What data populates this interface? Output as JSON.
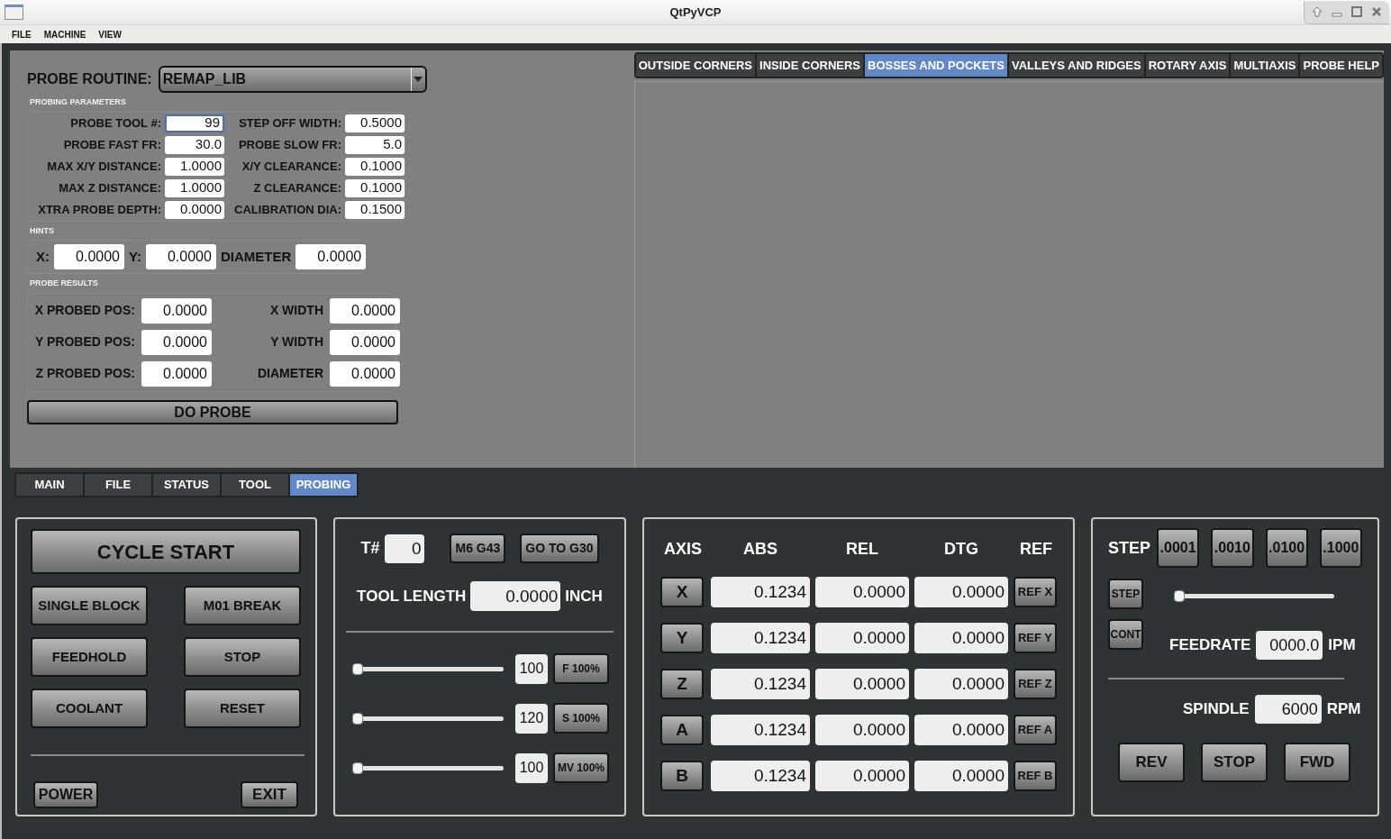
{
  "window": {
    "title": "QtPyVCP"
  },
  "menu": [
    "FILE",
    "MACHINE",
    "VIEW"
  ],
  "probe_routine": {
    "label": "PROBE ROUTINE:",
    "value": "REMAP_LIB"
  },
  "probing_parameters": {
    "title": "PROBING PARAMETERS",
    "fields": [
      {
        "label": "PROBE TOOL #:",
        "value": "99",
        "focused": true
      },
      {
        "label": "STEP OFF WIDTH:",
        "value": "0.5000",
        "focused": false
      },
      {
        "label": "PROBE FAST FR:",
        "value": "30.0",
        "focused": false
      },
      {
        "label": "PROBE SLOW FR:",
        "value": "5.0",
        "focused": false
      },
      {
        "label": "MAX X/Y DISTANCE:",
        "value": "1.0000",
        "focused": false
      },
      {
        "label": "X/Y CLEARANCE:",
        "value": "0.1000",
        "focused": false
      },
      {
        "label": "MAX Z DISTANCE:",
        "value": "1.0000",
        "focused": false
      },
      {
        "label": "Z CLEARANCE:",
        "value": "0.1000",
        "focused": false
      },
      {
        "label": "XTRA PROBE DEPTH:",
        "value": "0.0000",
        "focused": false
      },
      {
        "label": "CALIBRATION DIA:",
        "value": "0.1500",
        "focused": false
      }
    ]
  },
  "hints": {
    "title": "HINTS",
    "fields": [
      {
        "label": "X:",
        "value": "0.0000"
      },
      {
        "label": "Y:",
        "value": "0.0000"
      },
      {
        "label": "DIAMETER",
        "value": "0.0000"
      }
    ]
  },
  "probe_results": {
    "title": "PROBE RESULTS",
    "fields": [
      {
        "label": "X PROBED POS:",
        "value": "0.0000"
      },
      {
        "label": "X WIDTH",
        "value": "0.0000"
      },
      {
        "label": "Y PROBED POS:",
        "value": "0.0000"
      },
      {
        "label": "Y WIDTH",
        "value": "0.0000"
      },
      {
        "label": "Z PROBED POS:",
        "value": "0.0000"
      },
      {
        "label": "DIAMETER",
        "value": "0.0000"
      }
    ]
  },
  "do_probe_button": "DO PROBE",
  "probe_tabs": [
    {
      "label": "OUTSIDE CORNERS",
      "selected": false
    },
    {
      "label": "INSIDE CORNERS",
      "selected": false
    },
    {
      "label": "BOSSES AND POCKETS",
      "selected": true
    },
    {
      "label": "VALLEYS AND RIDGES",
      "selected": false
    },
    {
      "label": "ROTARY AXIS",
      "selected": false
    },
    {
      "label": "MULTIAXIS",
      "selected": false
    },
    {
      "label": "PROBE HELP",
      "selected": false
    }
  ],
  "main_tabs": [
    {
      "label": "MAIN",
      "selected": false
    },
    {
      "label": "FILE",
      "selected": false
    },
    {
      "label": "STATUS",
      "selected": false
    },
    {
      "label": "TOOL",
      "selected": false
    },
    {
      "label": "PROBING",
      "selected": true
    }
  ],
  "machine_panel": {
    "cycle_start": "CYCLE START",
    "buttons": [
      "SINGLE BLOCK",
      "M01 BREAK",
      "FEEDHOLD",
      "STOP",
      "COOLANT",
      "RESET"
    ],
    "power": "POWER",
    "exit": "EXIT"
  },
  "tool_panel": {
    "tool_label": "T#",
    "tool_value": "0",
    "buttons": [
      "M6 G43",
      "GO TO G30"
    ],
    "length_label": "TOOL LENGTH",
    "length_value": "0.0000",
    "length_unit": "INCH",
    "overrides": [
      {
        "level": 0,
        "value": "100",
        "button": "F 100%"
      },
      {
        "level": 0,
        "value": "120",
        "button": "S 100%"
      },
      {
        "level": 0,
        "value": "100",
        "button": "MV 100%"
      }
    ]
  },
  "dro": {
    "columns": [
      "AXIS",
      "ABS",
      "REL",
      "DTG",
      "REF"
    ],
    "rows": [
      {
        "axis": "X",
        "abs": "0.1234",
        "rel": "0.0000",
        "dtg": "0.0000",
        "ref": "REF X"
      },
      {
        "axis": "Y",
        "abs": "0.1234",
        "rel": "0.0000",
        "dtg": "0.0000",
        "ref": "REF Y"
      },
      {
        "axis": "Z",
        "abs": "0.1234",
        "rel": "0.0000",
        "dtg": "0.0000",
        "ref": "REF Z"
      },
      {
        "axis": "A",
        "abs": "0.1234",
        "rel": "0.0000",
        "dtg": "0.0000",
        "ref": "REF A"
      },
      {
        "axis": "B",
        "abs": "0.1234",
        "rel": "0.0000",
        "dtg": "0.0000",
        "ref": "REF B"
      }
    ]
  },
  "jog_panel": {
    "step_label": "STEP",
    "steps": [
      ".0001",
      ".0010",
      ".0100",
      ".1000"
    ],
    "modes": [
      "STEP",
      "CONT"
    ],
    "level": 0,
    "feedrate_label": "FEEDRATE",
    "feedrate": "0000.0",
    "feedrate_unit": "IPM",
    "spindle_label": "SPINDLE",
    "spindle": "6000",
    "spindle_unit": "RPM",
    "spindle_buttons": [
      "REV",
      "STOP",
      "FWD"
    ]
  }
}
